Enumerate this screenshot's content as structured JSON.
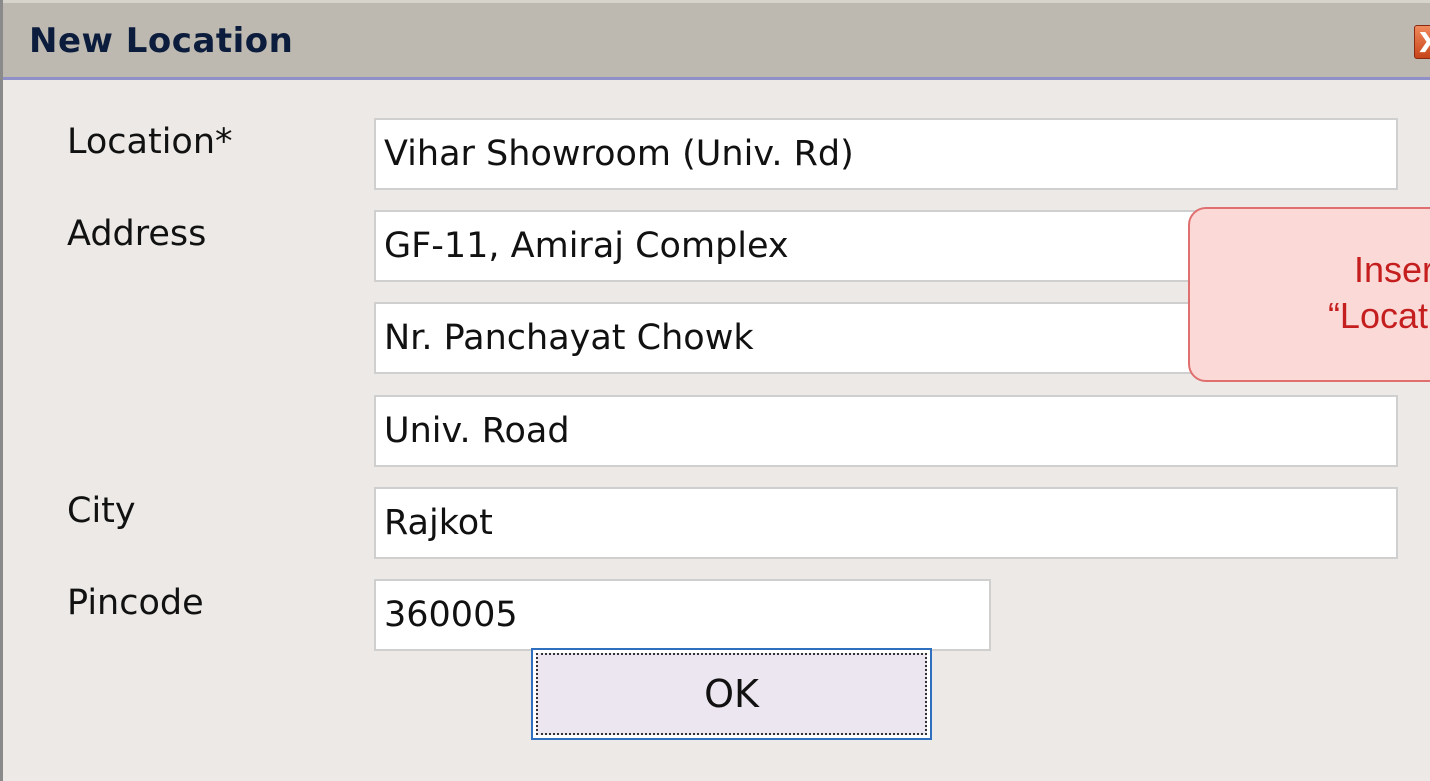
{
  "window": {
    "title": "New Location",
    "close_symbol": "X"
  },
  "form": {
    "location_label": "Location*",
    "location_value": "Vihar Showroom (Univ. Rd)",
    "address_label": "Address",
    "address_line1": "GF-11, Amiraj Complex",
    "address_line2": "Nr. Panchayat Chowk",
    "address_line3": "Univ. Road",
    "city_label": "City",
    "city_value": "Rajkot",
    "pincode_label": "Pincode",
    "pincode_value": "360005",
    "ok_label": "OK"
  },
  "callout": {
    "line1": "Insert re",
    "line2": "“Location N"
  },
  "colors": {
    "titlebar": "#bdb9b0",
    "title_text": "#0b1c3c",
    "callout_bg": "#fad9d7",
    "callout_text": "#c51e1e",
    "ok_border": "#2f6fbf"
  }
}
